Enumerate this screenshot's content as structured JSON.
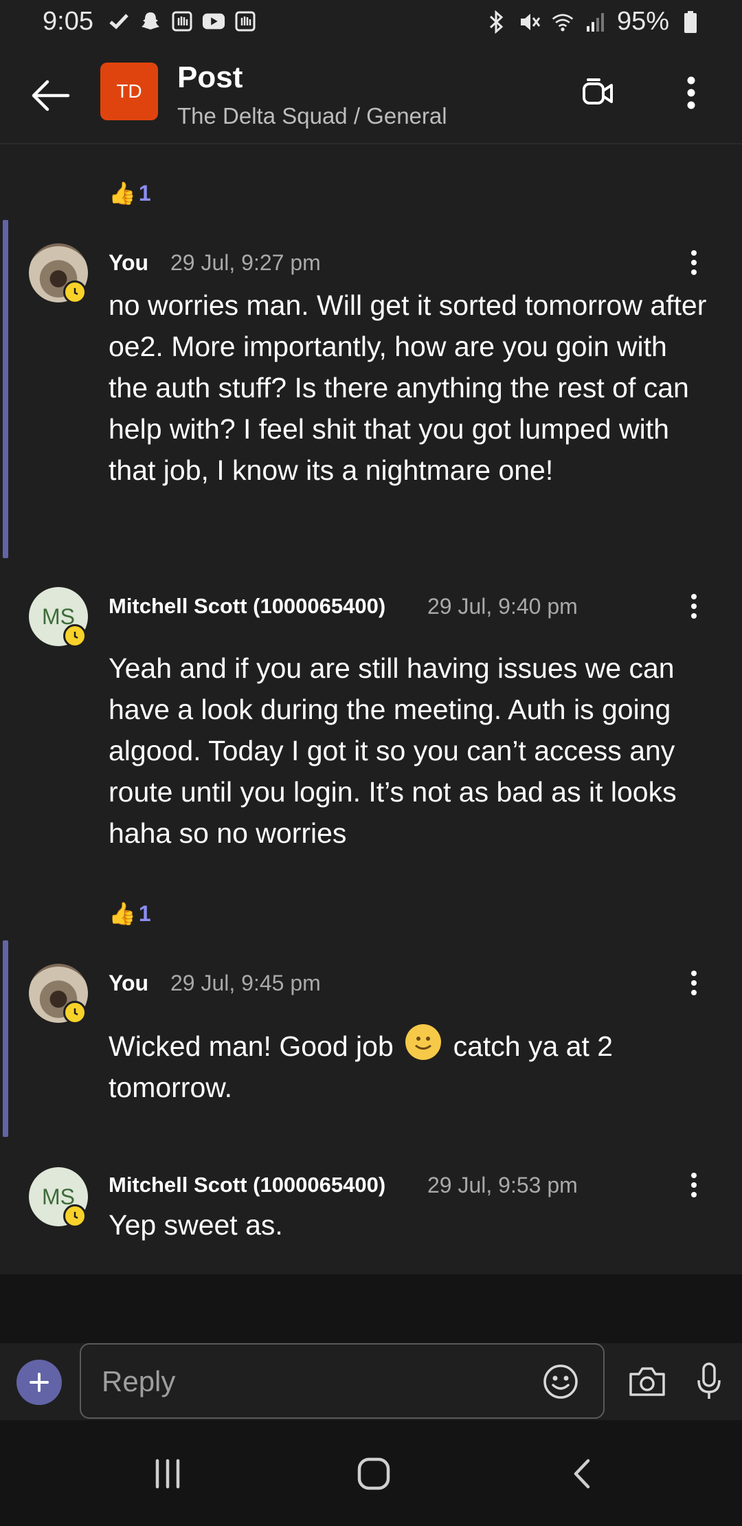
{
  "status_bar": {
    "time": "9:05",
    "battery": "95%",
    "left_icons": [
      "check-icon",
      "snapchat-icon",
      "hand-icon",
      "youtube-icon",
      "hand-icon"
    ],
    "right_icons": [
      "bluetooth-icon",
      "mute-icon",
      "wifi-icon",
      "signal-icon",
      "battery-icon"
    ]
  },
  "header": {
    "team_initials": "TD",
    "title": "Post",
    "subtitle": "The Delta Squad / General",
    "team_color": "#e0440e"
  },
  "thread": {
    "reaction_1": {
      "emoji": "👍",
      "count": "1"
    },
    "messages": [
      {
        "author": "You",
        "time": "29 Jul, 9:27 pm",
        "text": "no worries man. Will get it sorted tomorrow after oe2. More importantly, how are you goin with the auth stuff? Is there anything the rest of can help with? I feel shit that you got lumped with that job, I know its a nightmare one!"
      },
      {
        "author": "Mitchell Scott (1000065400)",
        "initials": "MS",
        "time": "29 Jul, 9:40 pm",
        "text": "Yeah and if you are still having issues we can have a look during the meeting. Auth is going algood. Today I got it so you can’t access any route until you login. It’s not as bad as it looks haha so no worries"
      },
      {
        "author": "You",
        "time": "29 Jul, 9:45 pm",
        "text_before": "Wicked man! Good job",
        "text_after": "catch ya at 2 tomorrow."
      },
      {
        "author": "Mitchell Scott (1000065400)",
        "initials": "MS",
        "time": "29 Jul, 9:53 pm",
        "text": "Yep sweet as."
      }
    ],
    "reaction_2": {
      "emoji": "👍",
      "count": "1"
    }
  },
  "compose": {
    "placeholder": "Reply"
  },
  "colors": {
    "accent": "#6264a7",
    "background": "#1f1f1f",
    "presence_away": "#f8d22a"
  }
}
